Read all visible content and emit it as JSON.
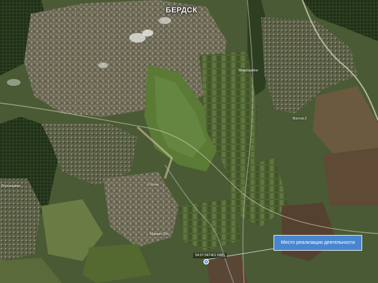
{
  "map": {
    "type": "satellite",
    "city_label": "БЕРДСК",
    "places": [
      {
        "id": "mikrorayon",
        "label": "Микрорайон"
      },
      {
        "id": "vostok",
        "label": "Восток-2"
      },
      {
        "id": "vorontsovka",
        "label": "Воронцовка"
      },
      {
        "id": "sosny",
        "label": "Сосны"
      },
      {
        "id": "lesnoy",
        "label": "Марьин Лог"
      }
    ],
    "marker": {
      "cadastral_number": "54:07:047401:5985",
      "icon": "location-pin-icon"
    },
    "callout": {
      "text": "Место реализации деятельности",
      "color": "#4a86cf"
    }
  }
}
